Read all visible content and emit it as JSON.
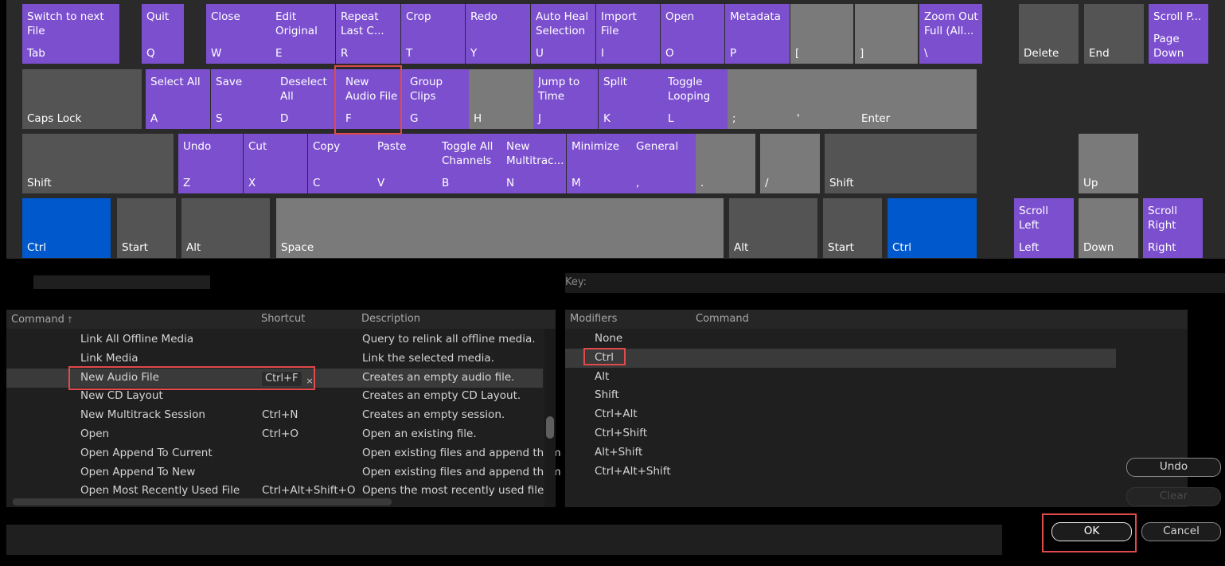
{
  "keyboard": {
    "row1": [
      {
        "cmd": "Switch to next File",
        "label": "Tab",
        "style": "purple"
      },
      {
        "cmd": "Quit",
        "label": "Q",
        "style": "purple"
      },
      {
        "cmd": "Close",
        "label": "W",
        "style": "purple"
      },
      {
        "cmd": "Edit Original",
        "label": "E",
        "style": "purple"
      },
      {
        "cmd": "Repeat Last C...",
        "label": "R",
        "style": "purple"
      },
      {
        "cmd": "Crop",
        "label": "T",
        "style": "purple"
      },
      {
        "cmd": "Redo",
        "label": "Y",
        "style": "purple"
      },
      {
        "cmd": "Auto Heal Selection",
        "label": "U",
        "style": "purple"
      },
      {
        "cmd": "Import File",
        "label": "I",
        "style": "purple"
      },
      {
        "cmd": "Open",
        "label": "O",
        "style": "purple"
      },
      {
        "cmd": "Metadata",
        "label": "P",
        "style": "purple"
      },
      {
        "cmd": "",
        "label": "[",
        "style": "gray"
      },
      {
        "cmd": "",
        "label": "]",
        "style": "gray"
      },
      {
        "cmd": "Zoom Out Full (All...",
        "label": "\\",
        "style": "purple"
      },
      {
        "cmd": "",
        "label": "Delete",
        "style": "dgray"
      },
      {
        "cmd": "",
        "label": "End",
        "style": "dgray"
      },
      {
        "cmd": "Scroll P...",
        "label": "Page Down",
        "style": "purple"
      }
    ],
    "row2": [
      {
        "cmd": "",
        "label": "Caps Lock",
        "style": "dgray"
      },
      {
        "cmd": "Select All",
        "label": "A",
        "style": "purple"
      },
      {
        "cmd": "Save",
        "label": "S",
        "style": "purple"
      },
      {
        "cmd": "Deselect All",
        "label": "D",
        "style": "purple"
      },
      {
        "cmd": "New Audio File",
        "label": "F",
        "style": "purple"
      },
      {
        "cmd": "Group Clips",
        "label": "G",
        "style": "purple"
      },
      {
        "cmd": "",
        "label": "H",
        "style": "gray"
      },
      {
        "cmd": "Jump to Time",
        "label": "J",
        "style": "purple"
      },
      {
        "cmd": "Split",
        "label": "K",
        "style": "purple"
      },
      {
        "cmd": "Toggle Looping",
        "label": "L",
        "style": "purple"
      },
      {
        "cmd": "",
        "label": ";",
        "style": "gray"
      },
      {
        "cmd": "",
        "label": "'",
        "style": "gray"
      },
      {
        "cmd": "",
        "label": "Enter",
        "style": "gray"
      }
    ],
    "row3": [
      {
        "cmd": "",
        "label": "Shift",
        "style": "dgray"
      },
      {
        "cmd": "Undo",
        "label": "Z",
        "style": "purple"
      },
      {
        "cmd": "Cut",
        "label": "X",
        "style": "purple"
      },
      {
        "cmd": "Copy",
        "label": "C",
        "style": "purple"
      },
      {
        "cmd": "Paste",
        "label": "V",
        "style": "purple"
      },
      {
        "cmd": "Toggle All Channels",
        "label": "B",
        "style": "purple"
      },
      {
        "cmd": "New Multitrac...",
        "label": "N",
        "style": "purple"
      },
      {
        "cmd": "Minimize",
        "label": "M",
        "style": "purple"
      },
      {
        "cmd": "General",
        "label": ",",
        "style": "purple"
      },
      {
        "cmd": "",
        "label": ".",
        "style": "gray"
      },
      {
        "cmd": "",
        "label": "/",
        "style": "gray"
      },
      {
        "cmd": "",
        "label": "Shift",
        "style": "dgray"
      },
      {
        "cmd": "",
        "label": "Up",
        "style": "gray"
      }
    ],
    "row4": [
      {
        "cmd": "",
        "label": "Ctrl",
        "style": "blue"
      },
      {
        "cmd": "",
        "label": "Start",
        "style": "dgray"
      },
      {
        "cmd": "",
        "label": "Alt",
        "style": "dgray"
      },
      {
        "cmd": "",
        "label": "Space",
        "style": "gray"
      },
      {
        "cmd": "",
        "label": "Alt",
        "style": "dgray"
      },
      {
        "cmd": "",
        "label": "Start",
        "style": "dgray"
      },
      {
        "cmd": "",
        "label": "Ctrl",
        "style": "blue"
      },
      {
        "cmd": "Scroll Left",
        "label": "Left",
        "style": "purple"
      },
      {
        "cmd": "",
        "label": "Down",
        "style": "gray"
      },
      {
        "cmd": "Scroll Right",
        "label": "Right",
        "style": "purple"
      }
    ]
  },
  "key_panel": {
    "label": "Key:"
  },
  "commands_table": {
    "headers": {
      "command": "Command",
      "sort_arrow": "🡑",
      "shortcut": "Shortcut",
      "description": "Description"
    },
    "rows": [
      {
        "command": "Link All Offline Media",
        "shortcut": "",
        "description": "Query to relink all offline media."
      },
      {
        "command": "Link Media",
        "shortcut": "",
        "description": "Link the selected media."
      },
      {
        "command": "New Audio File",
        "shortcut": "Ctrl+F",
        "description": "Creates an empty audio file.",
        "selected": true
      },
      {
        "command": "New CD Layout",
        "shortcut": "",
        "description": "Creates an empty CD Layout."
      },
      {
        "command": "New Multitrack Session",
        "shortcut": "Ctrl+N",
        "description": "Creates an empty session."
      },
      {
        "command": "Open",
        "shortcut": "Ctrl+O",
        "description": "Open an existing file."
      },
      {
        "command": "Open Append To Current",
        "shortcut": "",
        "description": "Open existing files and append them"
      },
      {
        "command": "Open Append To New",
        "shortcut": "",
        "description": "Open existing files and append them"
      },
      {
        "command": "Open Most Recently Used File",
        "shortcut": "Ctrl+Alt+Shift+O",
        "description": "Opens the most recently used file."
      }
    ],
    "chip_remove": "×"
  },
  "modifiers_table": {
    "headers": {
      "modifiers": "Modifiers",
      "command": "Command"
    },
    "rows": [
      "None",
      "Ctrl",
      "Alt",
      "Shift",
      "Ctrl+Alt",
      "Ctrl+Shift",
      "Alt+Shift",
      "Ctrl+Alt+Shift"
    ],
    "selected_index": 1
  },
  "buttons": {
    "undo": "Undo",
    "clear": "Clear",
    "ok": "OK",
    "cancel": "Cancel"
  }
}
